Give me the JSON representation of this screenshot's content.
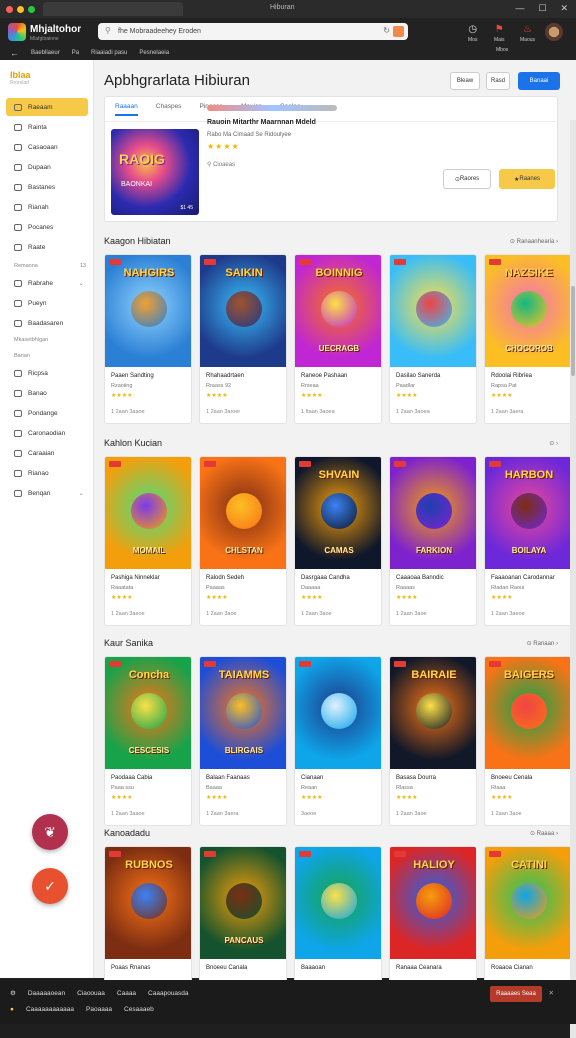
{
  "window": {
    "title": "Hiburan"
  },
  "browser": {
    "brand": "Mhjaltohor",
    "brand_sub": "Mlafgtirainne",
    "url": "fhe Mobraadeehey Eroden",
    "bookmarks": [
      "Baebllaeur",
      "Pa",
      "Riaaiadi pasu",
      "Pesnelaeia"
    ],
    "toolbar": [
      {
        "icon": "alarm-icon",
        "label": "Mos"
      },
      {
        "icon": "notification-icon",
        "label": "Mais"
      },
      {
        "icon": "flag-icon",
        "label": "Maous"
      },
      {
        "icon": "avatar-icon",
        "label": "Mbos"
      }
    ]
  },
  "sidebar": {
    "logo": "Iblaa",
    "logo_sub": "Rrorslad",
    "items": [
      {
        "label": "Raeaam",
        "active": true
      },
      {
        "label": "Rainta"
      },
      {
        "label": "Casaoaan"
      },
      {
        "label": "Dupaan"
      },
      {
        "label": "Bastanes"
      },
      {
        "label": "Rianah"
      },
      {
        "label": "Pocanes"
      },
      {
        "label": "Raate"
      }
    ],
    "section1": {
      "title": "Remaona",
      "count": "13"
    },
    "items2": [
      {
        "label": "Rabrahe",
        "chevron": true
      },
      {
        "label": "Pueyn"
      },
      {
        "label": "Baadasaren"
      }
    ],
    "section2": {
      "title": "Mkasetbhigan"
    },
    "section3": {
      "title": "Banan"
    },
    "items3": [
      {
        "label": "Ricpsa"
      },
      {
        "label": "Banao"
      },
      {
        "label": "Pondange"
      },
      {
        "label": "Caronaodian"
      },
      {
        "label": "Caraaian"
      },
      {
        "label": "Rianao"
      },
      {
        "label": "Benqan",
        "chevron": true
      }
    ]
  },
  "page": {
    "title": "Apbhgrarlata Hibiuran",
    "header_buttons": [
      "Bleaw",
      "Rasd",
      "Banaai"
    ],
    "tabs": [
      "Raaaan",
      "Chaspes",
      "Pinoaas",
      "Mauigs",
      "Caoleo"
    ],
    "featured": {
      "title": "Rauoin Mitarthr Maarnnan Mdeld",
      "subtitle": "Rabo Ma Cimaad Se Ridoulyee",
      "stars": "★★★★",
      "meta": "Cioaeas",
      "art_title": "RAOIG",
      "art_sub": "BAONKAI",
      "art_price": "$1 45",
      "btn_secondary": "Raores",
      "btn_primary": "Raanes"
    }
  },
  "sections": [
    {
      "title": "Kaagon Hibiatan",
      "more": "Ranaanhearia",
      "games": [
        {
          "art_top": "NAHGIRS",
          "art_bottom": "",
          "name": "Paaen Sandting",
          "sub": "Rzaoiing",
          "stars": "★★★★",
          "meta": "1  2aan     3aaoe"
        },
        {
          "art_top": "SAIKIN",
          "art_bottom": "",
          "name": "Rhahaadrtaen",
          "sub": "Rraass 92",
          "stars": "★★★★",
          "meta": "1 2aan     3aroer"
        },
        {
          "art_top": "BOINNIG",
          "art_bottom": "UECRAGB",
          "name": "Raneoe Pashaan",
          "sub": "Rrseaa",
          "stars": "★★★★",
          "meta": "1 Itaan     3aoea"
        },
        {
          "art_top": "",
          "art_bottom": "",
          "name": "Dasilao Sanerda",
          "sub": "Paadlar",
          "stars": "★★★★",
          "meta": "1 2aan     3aoea"
        },
        {
          "art_top": "NAZSIKE",
          "art_bottom": "CHOCOROB",
          "name": "Rdoolai Ribriea",
          "sub": "Rapsa Pat",
          "stars": "★★★★",
          "meta": "1 2aan     3aera"
        }
      ]
    },
    {
      "title": "Kahlon Kucian",
      "more": "",
      "games": [
        {
          "art_top": "",
          "art_bottom": "MOMAIL",
          "name": "Pashiga Ninneklar",
          "sub": "Raaatata",
          "stars": "★★★★",
          "meta": "1 2aan     3aeoe"
        },
        {
          "art_top": "",
          "art_bottom": "CHLSTAN",
          "name": "Ralodn Sedeh",
          "sub": "Paaaas",
          "stars": "★★★★",
          "meta": "1 2aan     3aoe"
        },
        {
          "art_top": "SHVAIN",
          "art_bottom": "CAMAS",
          "name": "Dasrgaaa Candha",
          "sub": "Daaaaa",
          "stars": "★★★★",
          "meta": "1 2aan     3aoe"
        },
        {
          "art_top": "",
          "art_bottom": "FARKION",
          "name": "Caaaoaa Banndic",
          "sub": "Raaaas",
          "stars": "★★★★",
          "meta": "1 2aan     3aoe"
        },
        {
          "art_top": "HARBON",
          "art_bottom": "BOILAYA",
          "name": "Faaaoanan Carodannar",
          "sub": "Rladan Raoui",
          "stars": "★★★★",
          "meta": "1 2aan     3aeoe"
        }
      ]
    },
    {
      "title": "Kaur Sanika",
      "more": "Ranaan",
      "games": [
        {
          "art_top": "Concha",
          "art_bottom": "CESCESIS",
          "name": "Paodaaa Cabia",
          "sub": "Paaa ssu",
          "stars": "★★★★",
          "meta": "1 2aan     3aaoe"
        },
        {
          "art_top": "TAIAMMS",
          "art_bottom": "BLIRGAIS",
          "name": "Balaan Faanaas",
          "sub": "Baaaa",
          "stars": "★★★★",
          "meta": "1 2aan     3aera"
        },
        {
          "art_top": "",
          "art_bottom": "",
          "name": "Cianaan",
          "sub": "Reaan",
          "stars": "★★★★",
          "meta": "3aeoe"
        },
        {
          "art_top": "BAIRAIE",
          "art_bottom": "",
          "name": "Basasa Dourra",
          "sub": "Rlassa",
          "stars": "★★★★",
          "meta": "1 2aan     3aoe"
        },
        {
          "art_top": "BAIGERS",
          "art_bottom": "",
          "name": "Bnoeeu Cenala",
          "sub": "Rlaaa",
          "stars": "★★★★",
          "meta": "1 2aan     3aoe"
        }
      ]
    },
    {
      "title": "Kanoadadu",
      "more": "Raaaa",
      "games": [
        {
          "art_top": "RUBNOS",
          "art_bottom": "",
          "name": "Poaas Rnanas",
          "sub": "",
          "stars": "",
          "meta": ""
        },
        {
          "art_top": "",
          "art_bottom": "PANCAUS",
          "name": "Bnoeeu Canala",
          "sub": "",
          "stars": "",
          "meta": ""
        },
        {
          "art_top": "",
          "art_bottom": "",
          "name": "Baaaoan",
          "sub": "",
          "stars": "",
          "meta": ""
        },
        {
          "art_top": "HALIOY",
          "art_bottom": "",
          "name": "Ranaaa Ceanara",
          "sub": "",
          "stars": "",
          "meta": ""
        },
        {
          "art_top": "CATINI",
          "art_bottom": "",
          "name": "Roaaoa Cianan",
          "sub": "",
          "stars": "",
          "meta": ""
        }
      ]
    }
  ],
  "footer": {
    "row1": [
      "Daaaaaoean",
      "Ciaoouaa",
      "Caaaa",
      "Caaapouasda"
    ],
    "row2": [
      "Caaaaaaaaaaaa",
      "Paoaaaa",
      "Cesaaaeb"
    ],
    "button": "Raaaaes Seaa"
  },
  "colors": {
    "accent": "#1a73e8",
    "active": "#f7c948",
    "dark": "#1f1f1f"
  }
}
